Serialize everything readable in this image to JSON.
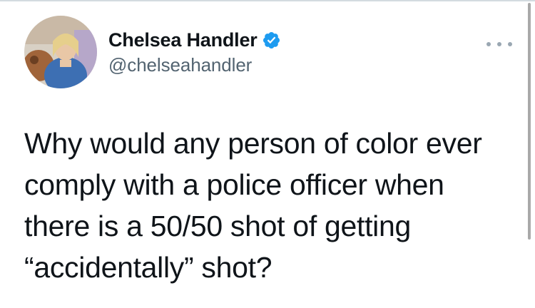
{
  "tweet": {
    "display_name": "Chelsea Handler",
    "handle": "@chelseahandler",
    "verified": true,
    "text": "Why would any person of color ever comply with a police officer when there is a 50/50 shot of getting “accidentally” shot?"
  },
  "icons": {
    "verified": "verified-badge-icon",
    "more": "more-options-icon",
    "avatar": "profile-avatar"
  },
  "colors": {
    "verified_blue": "#1d9bf0",
    "handle_gray": "#536471",
    "text": "#0f1419"
  }
}
